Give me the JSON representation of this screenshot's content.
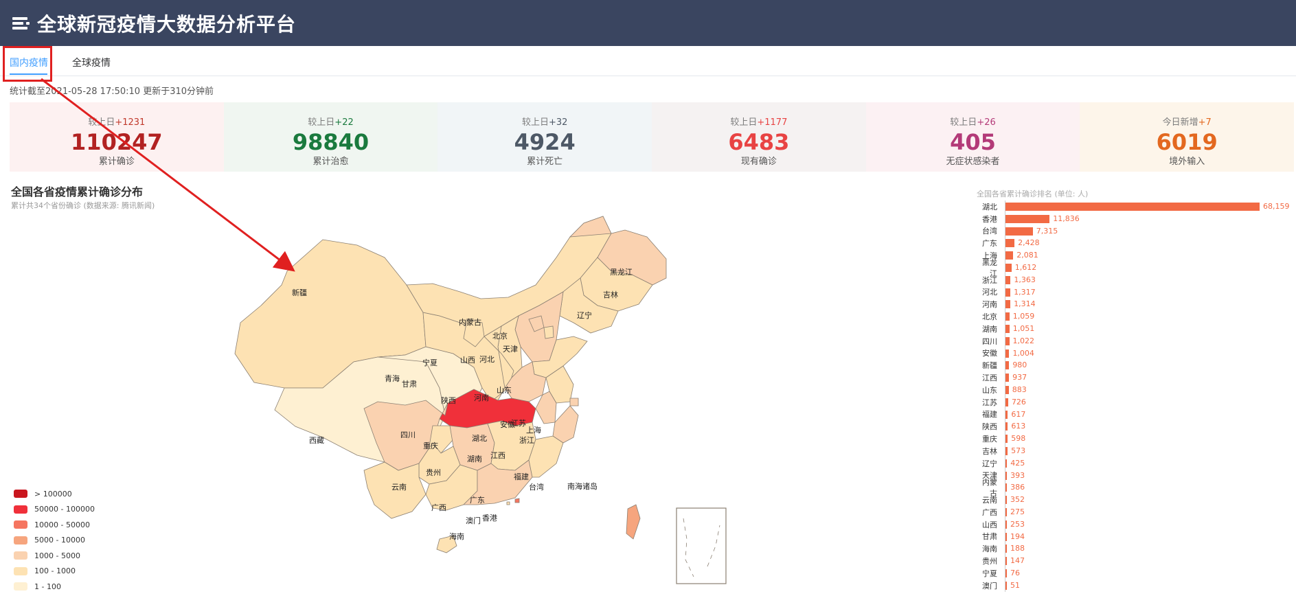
{
  "header": {
    "title": "全球新冠疫情大数据分析平台"
  },
  "tabs": [
    {
      "label": "国内疫情",
      "active": true
    },
    {
      "label": "全球疫情",
      "active": false
    }
  ],
  "update": {
    "text": "统计截至2021-05-28 17:50:10 更新于310分钟前"
  },
  "stats": [
    {
      "delta_label": "较上日",
      "delta": "+1231",
      "value": "110247",
      "label": "累计确诊",
      "color": "#b22222",
      "bg": "#fdf1f1",
      "delta_color": "#c0392b"
    },
    {
      "delta_label": "较上日",
      "delta": "+22",
      "value": "98840",
      "label": "累计治愈",
      "color": "#1a7a3e",
      "bg": "#f0f6f1",
      "delta_color": "#1a7a3e"
    },
    {
      "delta_label": "较上日",
      "delta": "+32",
      "value": "4924",
      "label": "累计死亡",
      "color": "#4d5866",
      "bg": "#f1f5f7",
      "delta_color": "#4d5866"
    },
    {
      "delta_label": "较上日",
      "delta": "+1177",
      "value": "6483",
      "label": "现有确诊",
      "color": "#e84343",
      "bg": "#f5f2f2",
      "delta_color": "#e84343"
    },
    {
      "delta_label": "较上日",
      "delta": "+26",
      "value": "405",
      "label": "无症状感染者",
      "color": "#b33a78",
      "bg": "#fcf1f3",
      "delta_color": "#b33a78"
    },
    {
      "delta_label": "今日新增",
      "delta": "+7",
      "value": "6019",
      "label": "境外输入",
      "color": "#e3681f",
      "bg": "#fdf5ea",
      "delta_color": "#e3681f"
    }
  ],
  "map_section": {
    "title": "全国各省疫情累计确诊分布",
    "subtitle": "累计共34个省份确诊 (数据来源: 腾讯新闻)",
    "province_labels": [
      "新疆",
      "西藏",
      "青海",
      "甘肃",
      "宁夏",
      "内蒙古",
      "黑龙江",
      "吉林",
      "辽宁",
      "北京",
      "天津",
      "河北",
      "山西",
      "山东",
      "陕西",
      "河南",
      "四川",
      "重庆",
      "湖北",
      "安徽",
      "江苏",
      "上海",
      "浙江",
      "湖南",
      "江西",
      "贵州",
      "云南",
      "广西",
      "广东",
      "福建",
      "台湾",
      "香港",
      "澳门",
      "海南",
      "南海诸岛"
    ]
  },
  "legend": [
    {
      "label": "> 100000",
      "color": "#c9161e"
    },
    {
      "label": "50000 - 100000",
      "color": "#f0303a"
    },
    {
      "label": "10000 - 50000",
      "color": "#f57560"
    },
    {
      "label": "5000 - 10000",
      "color": "#f6a57e"
    },
    {
      "label": "1000 - 5000",
      "color": "#fad2b0"
    },
    {
      "label": "100 - 1000",
      "color": "#fde2b3"
    },
    {
      "label": "1 - 100",
      "color": "#fef0d2"
    }
  ],
  "ranking": {
    "title": "全国各省累计确诊排名 (单位: 人)",
    "max": 68159,
    "items": [
      {
        "name": "湖北",
        "value": 68159,
        "label": "68,159"
      },
      {
        "name": "香港",
        "value": 11836,
        "label": "11,836"
      },
      {
        "name": "台湾",
        "value": 7315,
        "label": "7,315"
      },
      {
        "name": "广东",
        "value": 2428,
        "label": "2,428"
      },
      {
        "name": "上海",
        "value": 2081,
        "label": "2,081"
      },
      {
        "name": "黑龙江",
        "value": 1612,
        "label": "1,612"
      },
      {
        "name": "浙江",
        "value": 1363,
        "label": "1,363"
      },
      {
        "name": "河北",
        "value": 1317,
        "label": "1,317"
      },
      {
        "name": "河南",
        "value": 1314,
        "label": "1,314"
      },
      {
        "name": "北京",
        "value": 1059,
        "label": "1,059"
      },
      {
        "name": "湖南",
        "value": 1051,
        "label": "1,051"
      },
      {
        "name": "四川",
        "value": 1022,
        "label": "1,022"
      },
      {
        "name": "安徽",
        "value": 1004,
        "label": "1,004"
      },
      {
        "name": "新疆",
        "value": 980,
        "label": "980"
      },
      {
        "name": "江西",
        "value": 937,
        "label": "937"
      },
      {
        "name": "山东",
        "value": 883,
        "label": "883"
      },
      {
        "name": "江苏",
        "value": 726,
        "label": "726"
      },
      {
        "name": "福建",
        "value": 617,
        "label": "617"
      },
      {
        "name": "陕西",
        "value": 613,
        "label": "613"
      },
      {
        "name": "重庆",
        "value": 598,
        "label": "598"
      },
      {
        "name": "吉林",
        "value": 573,
        "label": "573"
      },
      {
        "name": "辽宁",
        "value": 425,
        "label": "425"
      },
      {
        "name": "天津",
        "value": 393,
        "label": "393"
      },
      {
        "name": "内蒙古",
        "value": 386,
        "label": "386"
      },
      {
        "name": "云南",
        "value": 352,
        "label": "352"
      },
      {
        "name": "广西",
        "value": 275,
        "label": "275"
      },
      {
        "name": "山西",
        "value": 253,
        "label": "253"
      },
      {
        "name": "甘肃",
        "value": 194,
        "label": "194"
      },
      {
        "name": "海南",
        "value": 188,
        "label": "188"
      },
      {
        "name": "贵州",
        "value": 147,
        "label": "147"
      },
      {
        "name": "宁夏",
        "value": 76,
        "label": "76"
      },
      {
        "name": "澳门",
        "value": 51,
        "label": "51"
      }
    ]
  }
}
